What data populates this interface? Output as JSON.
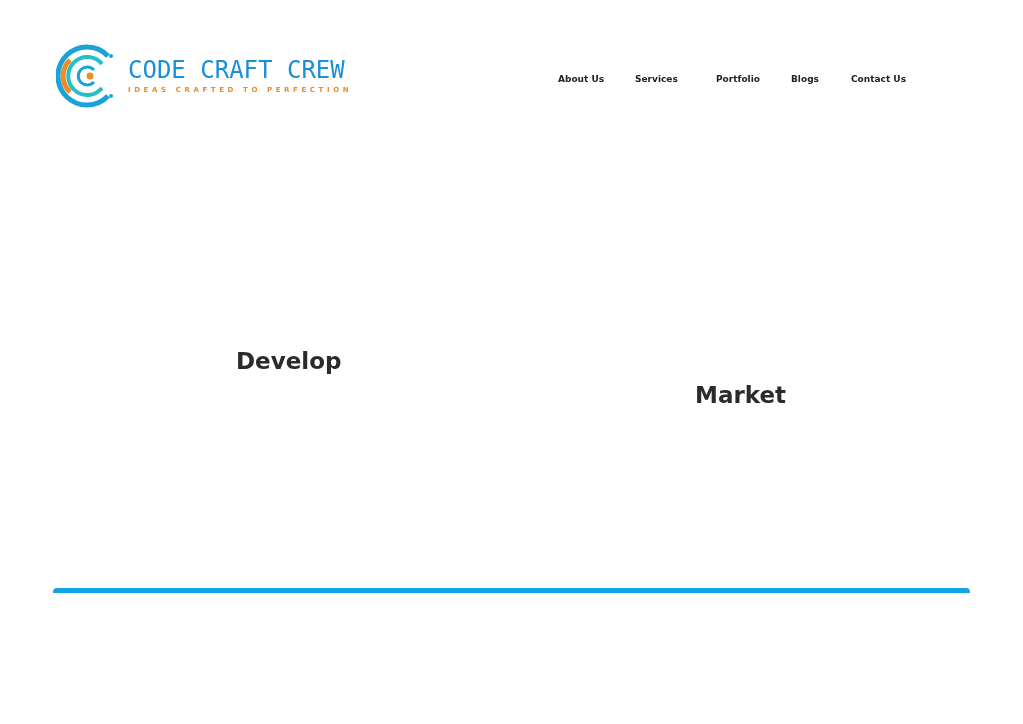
{
  "logo": {
    "name": "CODE CRAFT CREW",
    "tagline": "IDEAS CRAFTED TO PERFECTION"
  },
  "nav": [
    {
      "label": "About Us"
    },
    {
      "label": "Services"
    },
    {
      "label": "Portfolio"
    },
    {
      "label": "Blogs"
    },
    {
      "label": "Contact Us"
    }
  ],
  "headings": [
    "Develop",
    "Market"
  ]
}
